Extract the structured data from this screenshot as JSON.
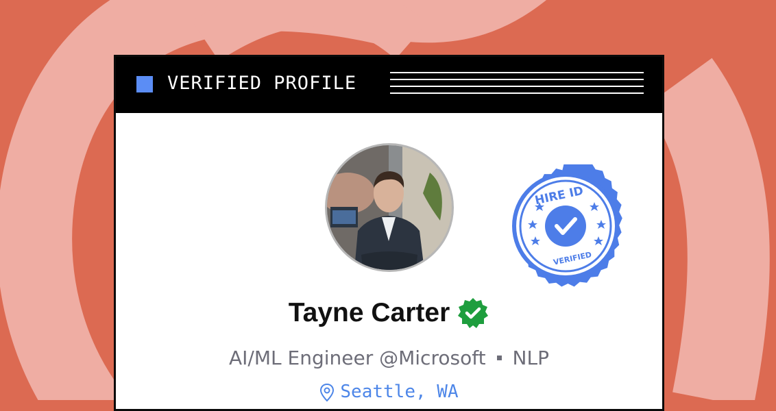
{
  "header": {
    "title": "VERIFIED PROFILE"
  },
  "seal": {
    "top_text": "HIRE ID",
    "bottom_text": "VERIFIED"
  },
  "profile": {
    "name": "Tayne Carter",
    "role": "AI/ML Engineer @Microsoft",
    "specialty": "NLP",
    "location": "Seattle, WA"
  },
  "colors": {
    "background": "#dc6a52",
    "accent_blue": "#5b8df5",
    "verified_green": "#1e9e3e",
    "seal_blue": "#4d7de8"
  },
  "icons": {
    "avatar": "profile-photo",
    "verified": "verified-check-icon",
    "location": "map-pin-icon",
    "seal": "hire-id-seal"
  }
}
